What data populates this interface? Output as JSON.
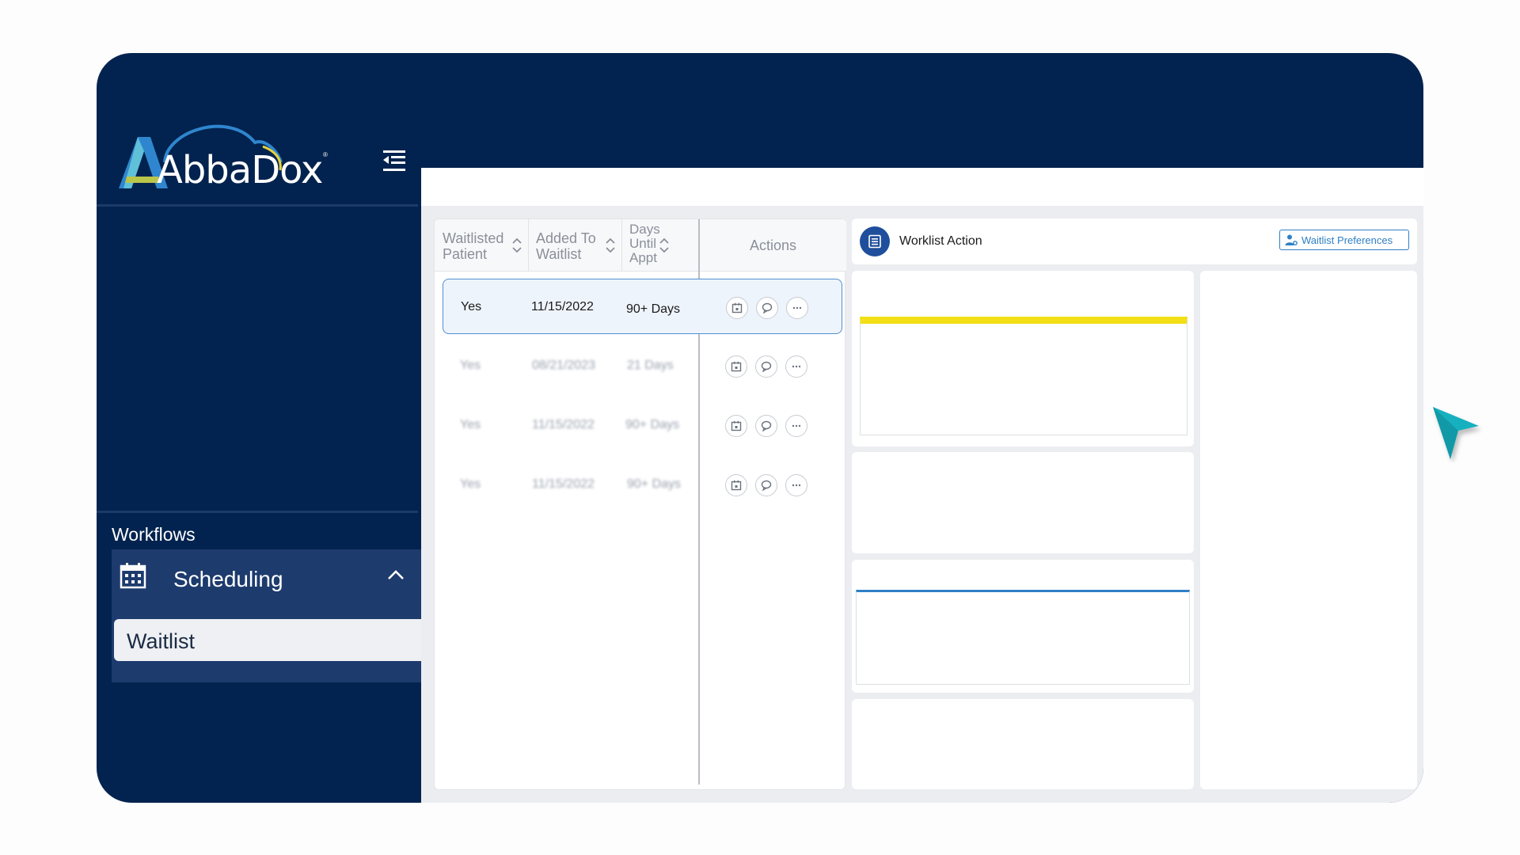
{
  "brand": {
    "name": "AbbaDox",
    "reg_mark": "®"
  },
  "sidebar": {
    "workflows_label": "Workflows",
    "section": {
      "label": "Scheduling",
      "icon": "calendar-icon",
      "expanded": true
    },
    "items": [
      {
        "label": "Waitlist",
        "active": true
      }
    ]
  },
  "table": {
    "columns": [
      {
        "line1": "Waitlisted",
        "line2": "Patient"
      },
      {
        "line1": "Added To",
        "line2": "Waitlist"
      },
      {
        "line1": "Days",
        "line2": "Until",
        "line3": "Appt"
      }
    ],
    "actions_header": "Actions",
    "rows": [
      {
        "waitlisted": "Yes",
        "added": "11/15/2022",
        "days": "90+ Days",
        "selected": true
      },
      {
        "waitlisted": "Yes",
        "added": "08/21/2023",
        "days": "21 Days",
        "selected": false
      },
      {
        "waitlisted": "Yes",
        "added": "11/15/2022",
        "days": "90+ Days",
        "selected": false
      },
      {
        "waitlisted": "Yes",
        "added": "11/15/2022",
        "days": "90+ Days",
        "selected": false
      }
    ]
  },
  "worklist": {
    "title": "Worklist Action",
    "preferences_label": "Waitlist Preferences"
  },
  "colors": {
    "sidebar_bg": "#02234f",
    "accent_blue": "#2f80c6",
    "highlight_yellow": "#f2df16",
    "cursor_teal": "#19b0bf"
  }
}
